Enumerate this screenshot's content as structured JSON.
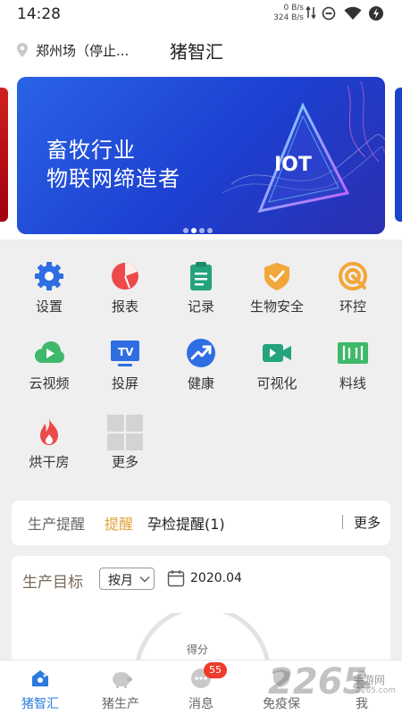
{
  "status_bar": {
    "time": "14:28",
    "net_up": "0 B/s",
    "net_down": "324 B/s"
  },
  "header": {
    "location": "郑州场（停止...",
    "title": "猪智汇"
  },
  "banner": {
    "line1": "畜牧行业",
    "line2": "物联网缔造者",
    "badge_text": "IOT",
    "dots": 4,
    "active_dot": 1
  },
  "grid": {
    "items": [
      {
        "label": "设置",
        "icon": "gear-icon",
        "color": "#2f6de3"
      },
      {
        "label": "报表",
        "icon": "pie-chart-icon",
        "color": "#ec4a4a"
      },
      {
        "label": "记录",
        "icon": "clipboard-icon",
        "color": "#25a37c"
      },
      {
        "label": "生物安全",
        "icon": "shield-check-icon",
        "color": "#f2a73a"
      },
      {
        "label": "环控",
        "icon": "target-icon",
        "color": "#f2a73a"
      },
      {
        "label": "云视频",
        "icon": "cloud-play-icon",
        "color": "#3fb86a"
      },
      {
        "label": "投屏",
        "icon": "tv-icon",
        "color": "#2f6de3"
      },
      {
        "label": "健康",
        "icon": "trend-icon",
        "color": "#2f6de3"
      },
      {
        "label": "可视化",
        "icon": "video-camera-icon",
        "color": "#25a37c"
      },
      {
        "label": "料线",
        "icon": "feed-line-icon",
        "color": "#3fb86a"
      },
      {
        "label": "烘干房",
        "icon": "flame-icon",
        "color": "#ec4a4a"
      },
      {
        "label": "更多",
        "icon": "more-grid-icon",
        "color": "#cfcfcf"
      }
    ]
  },
  "reminder": {
    "tabs": [
      {
        "label": "生产提醒",
        "color": "#666666"
      },
      {
        "label": "提醒",
        "color": "#e0a23a"
      },
      {
        "label": "孕检提醒(1)",
        "color": "#222222"
      }
    ],
    "more": "更多"
  },
  "target": {
    "title": "生产目标",
    "period": "按月",
    "date": "2020.04",
    "score_label": "得分"
  },
  "tabbar": {
    "tabs": [
      {
        "label": "猪智汇",
        "icon": "home-icon",
        "active": true
      },
      {
        "label": "猪生产",
        "icon": "pig-icon",
        "active": false
      },
      {
        "label": "消息",
        "icon": "message-icon",
        "active": false,
        "badge": "55"
      },
      {
        "label": "免疫保",
        "icon": "shield-icon",
        "active": false
      },
      {
        "label": "我",
        "icon": "user-icon",
        "active": false
      }
    ]
  },
  "watermark": {
    "number": "2265",
    "site": "手游网",
    "domain": "2265.com"
  }
}
